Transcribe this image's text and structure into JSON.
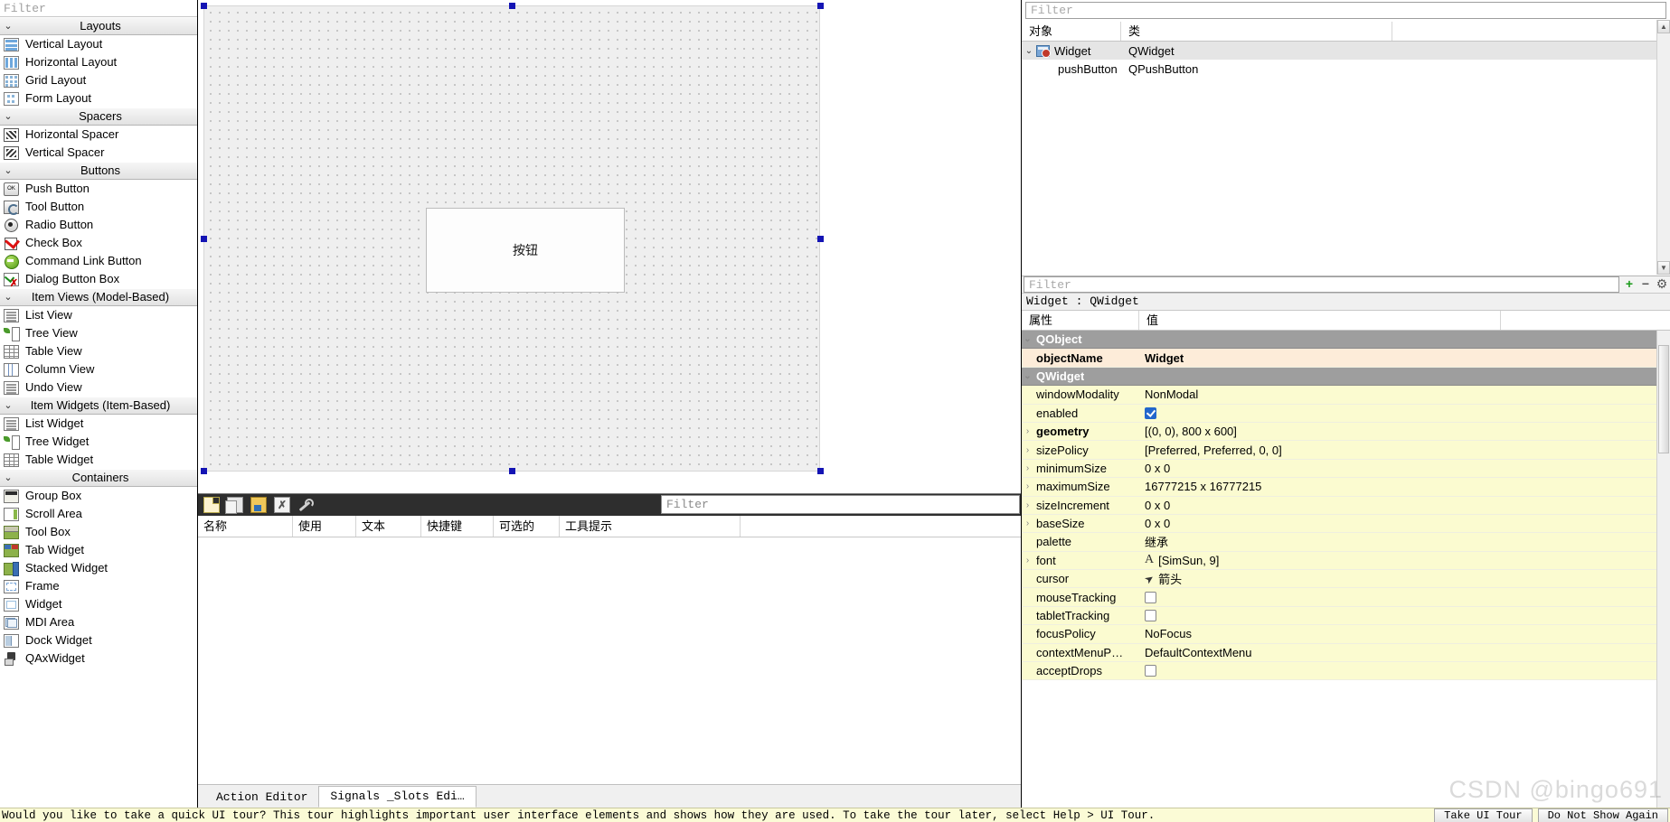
{
  "widget_box": {
    "filter_placeholder": "Filter",
    "groups": [
      {
        "title": "Layouts",
        "icon": "chevron-down-icon",
        "items": [
          {
            "label": "Vertical Layout",
            "icon": "vertical-layout-icon"
          },
          {
            "label": "Horizontal Layout",
            "icon": "horizontal-layout-icon"
          },
          {
            "label": "Grid Layout",
            "icon": "grid-layout-icon"
          },
          {
            "label": "Form Layout",
            "icon": "form-layout-icon"
          }
        ]
      },
      {
        "title": "Spacers",
        "icon": "chevron-down-icon",
        "items": [
          {
            "label": "Horizontal Spacer",
            "icon": "horizontal-spacer-icon"
          },
          {
            "label": "Vertical Spacer",
            "icon": "vertical-spacer-icon"
          }
        ]
      },
      {
        "title": "Buttons",
        "icon": "chevron-down-icon",
        "items": [
          {
            "label": "Push Button",
            "icon": "push-button-icon"
          },
          {
            "label": "Tool Button",
            "icon": "tool-button-icon"
          },
          {
            "label": "Radio Button",
            "icon": "radio-button-icon"
          },
          {
            "label": "Check Box",
            "icon": "check-box-icon"
          },
          {
            "label": "Command Link Button",
            "icon": "command-link-button-icon"
          },
          {
            "label": "Dialog Button Box",
            "icon": "dialog-button-box-icon"
          }
        ]
      },
      {
        "title": "Item Views (Model-Based)",
        "icon": "chevron-down-icon",
        "items": [
          {
            "label": "List View",
            "icon": "list-view-icon"
          },
          {
            "label": "Tree View",
            "icon": "tree-view-icon"
          },
          {
            "label": "Table View",
            "icon": "table-view-icon"
          },
          {
            "label": "Column View",
            "icon": "column-view-icon"
          },
          {
            "label": "Undo View",
            "icon": "undo-view-icon"
          }
        ]
      },
      {
        "title": "Item Widgets (Item-Based)",
        "icon": "chevron-down-icon",
        "items": [
          {
            "label": "List Widget",
            "icon": "list-widget-icon"
          },
          {
            "label": "Tree Widget",
            "icon": "tree-widget-icon"
          },
          {
            "label": "Table Widget",
            "icon": "table-widget-icon"
          }
        ]
      },
      {
        "title": "Containers",
        "icon": "chevron-down-icon",
        "items": [
          {
            "label": "Group Box",
            "icon": "group-box-icon"
          },
          {
            "label": "Scroll Area",
            "icon": "scroll-area-icon"
          },
          {
            "label": "Tool Box",
            "icon": "tool-box-icon"
          },
          {
            "label": "Tab Widget",
            "icon": "tab-widget-icon"
          },
          {
            "label": "Stacked Widget",
            "icon": "stacked-widget-icon"
          },
          {
            "label": "Frame",
            "icon": "frame-icon"
          },
          {
            "label": "Widget",
            "icon": "widget-icon"
          },
          {
            "label": "MDI Area",
            "icon": "mdi-area-icon"
          },
          {
            "label": "Dock Widget",
            "icon": "dock-widget-icon"
          },
          {
            "label": "QAxWidget",
            "icon": "qax-widget-icon"
          }
        ]
      }
    ]
  },
  "form": {
    "button_text": "按钮"
  },
  "action_editor": {
    "toolbar": [
      {
        "name": "new-action",
        "icon": "new-action-icon"
      },
      {
        "name": "copy-action",
        "icon": "copy-action-icon"
      },
      {
        "name": "edit-action",
        "icon": "edit-action-icon"
      },
      {
        "name": "delete-action",
        "icon": "delete-action-icon"
      },
      {
        "name": "configure",
        "icon": "wrench-icon"
      }
    ],
    "filter_placeholder": "Filter",
    "columns": [
      "名称",
      "使用",
      "文本",
      "快捷键",
      "可选的",
      "工具提示"
    ],
    "rows": [],
    "tabs": [
      {
        "label": "Action Editor",
        "active": false
      },
      {
        "label": "Signals _Slots Edi…",
        "active": true
      }
    ]
  },
  "object_inspector": {
    "filter_placeholder": "Filter",
    "columns": [
      "对象",
      "类"
    ],
    "rows": [
      {
        "object": "Widget",
        "class": "QWidget",
        "indent": 0,
        "expanded": true,
        "selected": true,
        "icon": "qwidget-icon"
      },
      {
        "object": "pushButton",
        "class": "QPushButton",
        "indent": 1,
        "expanded": false,
        "selected": false,
        "icon": ""
      }
    ]
  },
  "property_editor": {
    "filter_placeholder": "Filter",
    "add_label": "+",
    "remove_label": "−",
    "configure_label": "⚙",
    "title": "Widget : QWidget",
    "columns": [
      "属性",
      "值"
    ],
    "rows": [
      {
        "key": "QObject",
        "value": "",
        "type": "group",
        "expandable": true
      },
      {
        "key": "objectName",
        "value": "Widget",
        "type": "objectname",
        "expandable": false
      },
      {
        "key": "QWidget",
        "value": "",
        "type": "group",
        "expandable": true
      },
      {
        "key": "windowModality",
        "value": "NonModal",
        "type": "text",
        "expandable": false
      },
      {
        "key": "enabled",
        "value": "",
        "type": "checkbox-on",
        "expandable": false
      },
      {
        "key": "geometry",
        "value": "[(0, 0), 800 x 600]",
        "type": "bold",
        "expandable": true
      },
      {
        "key": "sizePolicy",
        "value": "[Preferred, Preferred, 0, 0]",
        "type": "text",
        "expandable": true
      },
      {
        "key": "minimumSize",
        "value": "0 x 0",
        "type": "text",
        "expandable": true
      },
      {
        "key": "maximumSize",
        "value": "16777215 x 16777215",
        "type": "text",
        "expandable": true
      },
      {
        "key": "sizeIncrement",
        "value": "0 x 0",
        "type": "text",
        "expandable": true
      },
      {
        "key": "baseSize",
        "value": "0 x 0",
        "type": "text",
        "expandable": true
      },
      {
        "key": "palette",
        "value": "继承",
        "type": "text",
        "expandable": false
      },
      {
        "key": "font",
        "value": "[SimSun, 9]",
        "type": "font",
        "expandable": true
      },
      {
        "key": "cursor",
        "value": "箭头",
        "type": "cursor",
        "expandable": false
      },
      {
        "key": "mouseTracking",
        "value": "",
        "type": "checkbox-off",
        "expandable": false
      },
      {
        "key": "tabletTracking",
        "value": "",
        "type": "checkbox-off",
        "expandable": false
      },
      {
        "key": "focusPolicy",
        "value": "NoFocus",
        "type": "text",
        "expandable": false
      },
      {
        "key": "contextMenuP…",
        "value": "DefaultContextMenu",
        "type": "text",
        "expandable": false
      },
      {
        "key": "acceptDrops",
        "value": "",
        "type": "checkbox-off",
        "expandable": false
      }
    ]
  },
  "tour_bar": {
    "message": "Would you like to take a quick UI tour? This tour highlights important user interface elements and shows how they are used. To take the tour later, select Help > UI Tour.",
    "take_tour_label": "Take UI Tour",
    "dismiss_label": "Do Not Show Again"
  },
  "watermark": "CSDN @bingo691"
}
